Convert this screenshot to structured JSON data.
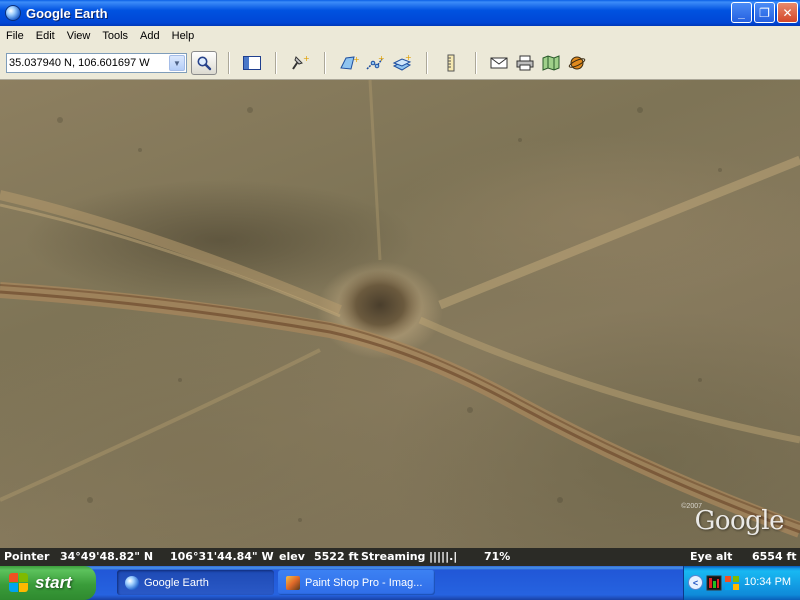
{
  "window": {
    "title": "Google Earth",
    "buttons": {
      "minimize": "_",
      "maximize": "❐",
      "close": "✕"
    }
  },
  "menu": [
    "File",
    "Edit",
    "View",
    "Tools",
    "Add",
    "Help"
  ],
  "toolbar": {
    "search_value": "35.037940 N, 106.601697 W",
    "dropdown_arrow": "▼"
  },
  "map": {
    "copyright": "©2007",
    "watermark": "Google"
  },
  "status": {
    "pointer_label": "Pointer",
    "latitude": "34°49'48.82\" N",
    "longitude": "106°31'44.84\" W",
    "elev_label": "elev",
    "elev_value": "5522 ft",
    "streaming_label": "Streaming",
    "streaming_bar": "|||||.|",
    "streaming_percent": "71%",
    "eye_alt_label": "Eye alt",
    "eye_alt_value": "6554 ft"
  },
  "taskbar": {
    "start_label": "start",
    "tasks": [
      {
        "label": "Google Earth"
      },
      {
        "label": "Paint Shop Pro - Imag..."
      }
    ],
    "tray_chevron": "<",
    "clock": "10:34 PM"
  },
  "colors": {
    "title_bar": "#0052e0",
    "menu_bg": "#ece9d8",
    "taskbar": "#2663e0",
    "start_green": "#3a9c3a",
    "tray": "#0f8ad9"
  }
}
